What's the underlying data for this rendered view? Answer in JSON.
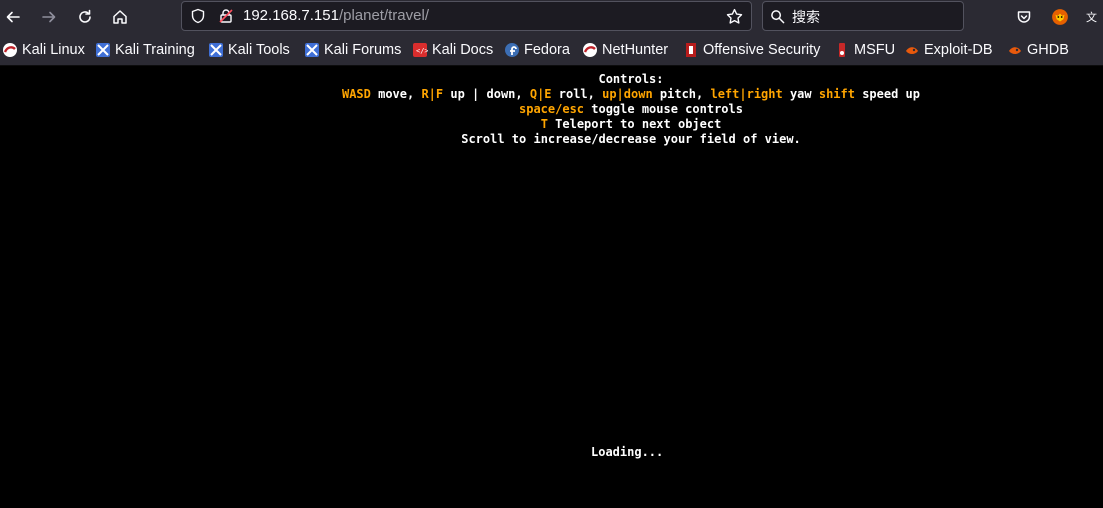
{
  "browser": {
    "url_host": "192.168.7.151",
    "url_path": "/planet/travel/",
    "search_placeholder": "搜索",
    "bookmarks": [
      {
        "label": "Kali Linux",
        "icon": "kali-icon"
      },
      {
        "label": "Kali Training",
        "icon": "kali-training-icon"
      },
      {
        "label": "Kali Tools",
        "icon": "kali-tools-icon"
      },
      {
        "label": "Kali Forums",
        "icon": "kali-forums-icon"
      },
      {
        "label": "Kali Docs",
        "icon": "kali-docs-icon"
      },
      {
        "label": "Fedora",
        "icon": "fedora-icon"
      },
      {
        "label": "NetHunter",
        "icon": "nethunter-icon"
      },
      {
        "label": "Offensive Security",
        "icon": "offsec-icon"
      },
      {
        "label": "MSFU",
        "icon": "msfu-icon"
      },
      {
        "label": "Exploit-DB",
        "icon": "exploit-db-icon"
      },
      {
        "label": "GHDB",
        "icon": "ghdb-icon"
      }
    ]
  },
  "page": {
    "controls_title": "Controls:",
    "line1": {
      "k1": "WASD",
      "t1": " move, ",
      "k2": "R|F",
      "t2": " up | down, ",
      "k3": "Q|E",
      "t3": " roll, ",
      "k4": "up|down",
      "t4": " pitch, ",
      "k5": "left|right",
      "t5": " yaw ",
      "k6": "shift",
      "t6": " speed up"
    },
    "line2": {
      "k1": "space/esc",
      "t1": " toggle mouse controls"
    },
    "line3": {
      "k1": "T",
      "t1": " Teleport to next object"
    },
    "line4": "Scroll to increase/decrease your field of view.",
    "loading": "Loading...",
    "key_color": "#ffa500"
  }
}
